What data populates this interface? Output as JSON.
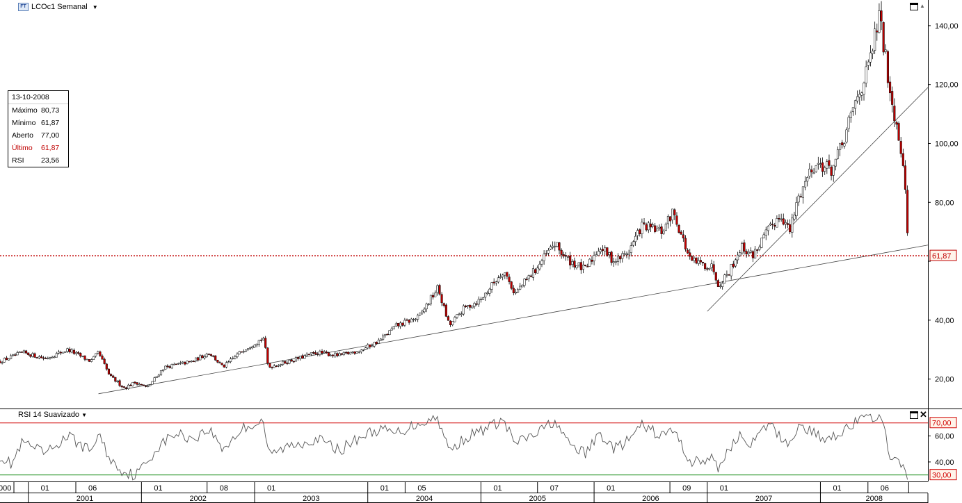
{
  "header": {
    "symbol_label": "LCOc1 Semanal",
    "icon": "ft-icon",
    "dropdown_icon": "chevron-down-icon"
  },
  "rsi_header": {
    "label": "RSI 14 Suavizado",
    "dropdown_icon": "chevron-down-icon"
  },
  "infobox": {
    "date": "13-10-2008",
    "rows": [
      {
        "key": "Máximo",
        "value": "80,73"
      },
      {
        "key": "Mínimo",
        "value": "61,87"
      },
      {
        "key": "Aberto",
        "value": "77,00"
      },
      {
        "key": "Último",
        "value": "61,87"
      },
      {
        "key": "RSI",
        "value": "23,56"
      }
    ]
  },
  "colors": {
    "up": "#ffffff",
    "down": "#c00000",
    "rsi_upper": "#d00000",
    "rsi_lower": "#008000",
    "price_line": "#c00000",
    "rsi_line": "#555555"
  },
  "chart_data": [
    {
      "type": "candlestick",
      "title": "LCOc1 Semanal",
      "y_axis_side": "right",
      "ylim": [
        10,
        148
      ],
      "y_ticks": [
        20,
        40,
        60,
        80,
        100,
        120,
        140
      ],
      "y_tick_labels": [
        "20,00",
        "40,00",
        "",
        "80,00",
        "100,00",
        "120,00",
        "140,00"
      ],
      "last_price": 61.87,
      "last_price_label": "61,87",
      "x_range": [
        2000.75,
        2008.95
      ],
      "anchors": [
        [
          2000.75,
          26
        ],
        [
          2000.95,
          29
        ],
        [
          2001.15,
          27
        ],
        [
          2001.35,
          30
        ],
        [
          2001.55,
          26
        ],
        [
          2001.62,
          29
        ],
        [
          2001.72,
          21
        ],
        [
          2001.85,
          17
        ],
        [
          2001.95,
          19
        ],
        [
          2002.05,
          17
        ],
        [
          2002.2,
          24
        ],
        [
          2002.45,
          26
        ],
        [
          2002.6,
          29
        ],
        [
          2002.72,
          24
        ],
        [
          2002.9,
          30
        ],
        [
          2003.08,
          34
        ],
        [
          2003.12,
          24
        ],
        [
          2003.3,
          26
        ],
        [
          2003.55,
          29
        ],
        [
          2003.75,
          28
        ],
        [
          2003.95,
          30
        ],
        [
          2004.1,
          33
        ],
        [
          2004.25,
          38
        ],
        [
          2004.45,
          41
        ],
        [
          2004.62,
          51
        ],
        [
          2004.72,
          38
        ],
        [
          2004.85,
          44
        ],
        [
          2005.0,
          47
        ],
        [
          2005.2,
          57
        ],
        [
          2005.3,
          49
        ],
        [
          2005.5,
          58
        ],
        [
          2005.65,
          66
        ],
        [
          2005.75,
          61
        ],
        [
          2005.92,
          57
        ],
        [
          2006.05,
          65
        ],
        [
          2006.18,
          60
        ],
        [
          2006.3,
          63
        ],
        [
          2006.42,
          72
        ],
        [
          2006.6,
          70
        ],
        [
          2006.7,
          77
        ],
        [
          2006.85,
          60
        ],
        [
          2007.05,
          58
        ],
        [
          2007.1,
          52
        ],
        [
          2007.2,
          57
        ],
        [
          2007.3,
          65
        ],
        [
          2007.4,
          62
        ],
        [
          2007.55,
          71
        ],
        [
          2007.65,
          76
        ],
        [
          2007.73,
          70
        ],
        [
          2007.8,
          81
        ],
        [
          2007.92,
          92
        ],
        [
          2008.0,
          93
        ],
        [
          2008.1,
          91
        ],
        [
          2008.2,
          100
        ],
        [
          2008.3,
          113
        ],
        [
          2008.42,
          125
        ],
        [
          2008.52,
          143
        ],
        [
          2008.58,
          128
        ],
        [
          2008.62,
          117
        ],
        [
          2008.68,
          105
        ],
        [
          2008.73,
          95
        ],
        [
          2008.76,
          77
        ],
        [
          2008.78,
          62
        ]
      ],
      "trendlines": [
        {
          "from": [
            2001.62,
            15.0
          ],
          "to": [
            2008.95,
            65.5
          ]
        },
        {
          "from": [
            2007.0,
            43.0
          ],
          "to": [
            2008.95,
            119.0
          ]
        }
      ]
    },
    {
      "type": "line",
      "title": "RSI 14 Suavizado",
      "ylim": [
        25,
        80
      ],
      "y_tick_labels": [
        "60,00",
        "40,00"
      ],
      "y_ticks": [
        60,
        40
      ],
      "upper_level": 70,
      "upper_label": "70,00",
      "lower_level": 30,
      "lower_label": "30,00",
      "anchors": [
        [
          2000.75,
          45
        ],
        [
          2000.85,
          38
        ],
        [
          2000.95,
          55
        ],
        [
          2001.15,
          46
        ],
        [
          2001.35,
          60
        ],
        [
          2001.55,
          48
        ],
        [
          2001.62,
          62
        ],
        [
          2001.72,
          42
        ],
        [
          2001.85,
          32
        ],
        [
          2001.95,
          30
        ],
        [
          2002.05,
          40
        ],
        [
          2002.15,
          52
        ],
        [
          2002.3,
          62
        ],
        [
          2002.45,
          58
        ],
        [
          2002.6,
          65
        ],
        [
          2002.72,
          50
        ],
        [
          2002.9,
          66
        ],
        [
          2003.08,
          72
        ],
        [
          2003.12,
          45
        ],
        [
          2003.3,
          52
        ],
        [
          2003.55,
          58
        ],
        [
          2003.75,
          49
        ],
        [
          2003.95,
          60
        ],
        [
          2004.1,
          65
        ],
        [
          2004.25,
          62
        ],
        [
          2004.45,
          70
        ],
        [
          2004.62,
          74
        ],
        [
          2004.72,
          48
        ],
        [
          2004.85,
          58
        ],
        [
          2005.0,
          64
        ],
        [
          2005.2,
          72
        ],
        [
          2005.3,
          54
        ],
        [
          2005.5,
          62
        ],
        [
          2005.65,
          72
        ],
        [
          2005.75,
          56
        ],
        [
          2005.92,
          46
        ],
        [
          2006.05,
          62
        ],
        [
          2006.18,
          50
        ],
        [
          2006.3,
          56
        ],
        [
          2006.42,
          68
        ],
        [
          2006.6,
          60
        ],
        [
          2006.7,
          65
        ],
        [
          2006.85,
          40
        ],
        [
          2007.05,
          42
        ],
        [
          2007.1,
          35
        ],
        [
          2007.2,
          52
        ],
        [
          2007.3,
          60
        ],
        [
          2007.4,
          54
        ],
        [
          2007.55,
          70
        ],
        [
          2007.65,
          58
        ],
        [
          2007.73,
          55
        ],
        [
          2007.8,
          67
        ],
        [
          2007.92,
          64
        ],
        [
          2008.0,
          58
        ],
        [
          2008.1,
          60
        ],
        [
          2008.2,
          64
        ],
        [
          2008.3,
          70
        ],
        [
          2008.42,
          74
        ],
        [
          2008.52,
          76
        ],
        [
          2008.58,
          58
        ],
        [
          2008.62,
          45
        ],
        [
          2008.68,
          40
        ],
        [
          2008.73,
          34
        ],
        [
          2008.78,
          24
        ]
      ]
    }
  ],
  "x_axis": {
    "month_labels": [
      {
        "t": 2000.93,
        "label": "000"
      },
      {
        "t": 2001.0,
        "label": "01"
      },
      {
        "t": 2001.42,
        "label": "06"
      },
      {
        "t": 2002.0,
        "label": "01"
      },
      {
        "t": 2002.58,
        "label": "08"
      },
      {
        "t": 2003.0,
        "label": "01"
      },
      {
        "t": 2004.0,
        "label": "01"
      },
      {
        "t": 2004.33,
        "label": "05"
      },
      {
        "t": 2005.0,
        "label": "01"
      },
      {
        "t": 2005.5,
        "label": "07"
      },
      {
        "t": 2006.0,
        "label": "01"
      },
      {
        "t": 2006.67,
        "label": "09"
      },
      {
        "t": 2007.0,
        "label": "01"
      },
      {
        "t": 2008.0,
        "label": "01"
      },
      {
        "t": 2008.42,
        "label": "06"
      }
    ],
    "year_labels": [
      "2001",
      "2002",
      "2003",
      "2004",
      "2005",
      "2006",
      "2007",
      "2008"
    ]
  }
}
